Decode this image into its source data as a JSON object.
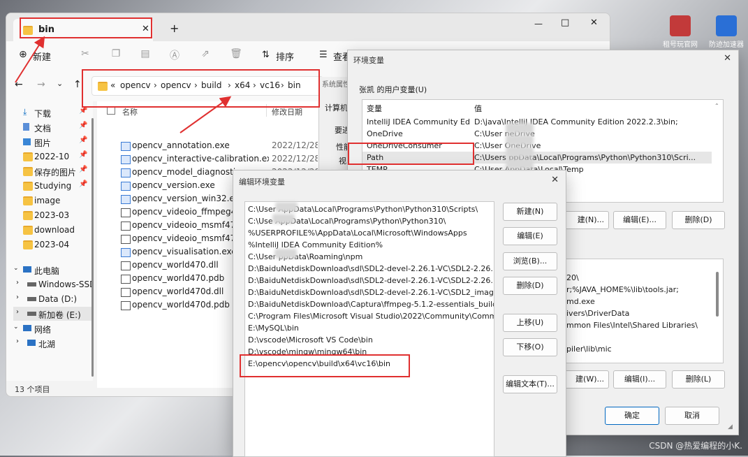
{
  "desktop": {
    "icons": [
      {
        "label": "租号玩官网",
        "color": "#c23a3a"
      },
      {
        "label": "防迹加速器",
        "color": "#2a6fd6"
      }
    ],
    "watermark": "CSDN @热爱编程的小K."
  },
  "explorer": {
    "tab_title": "bin",
    "new_tab_symbol": "+",
    "window_controls": [
      "—",
      "□",
      "✕"
    ],
    "toolbar": {
      "new_label": "新建",
      "sort_label": "排序",
      "view_label": "查看"
    },
    "breadcrumb": [
      "«",
      "opencv",
      "opencv",
      "build",
      "x64",
      "vc16",
      "bin"
    ],
    "sidebar": [
      {
        "label": "下载",
        "pinned": true
      },
      {
        "label": "文档",
        "pinned": true
      },
      {
        "label": "图片",
        "pinned": true
      },
      {
        "label": "2022-10",
        "pinned": true
      },
      {
        "label": "保存的图片",
        "pinned": true
      },
      {
        "label": "Studying",
        "pinned": true
      },
      {
        "label": "image",
        "pinned": false
      },
      {
        "label": "2023-03",
        "pinned": false
      },
      {
        "label": "download",
        "pinned": false
      },
      {
        "label": "2023-04",
        "pinned": false
      },
      {
        "label": "此电脑",
        "pinned": false
      },
      {
        "label": "Windows-SSD",
        "pinned": false
      },
      {
        "label": "Data (D:)",
        "pinned": false
      },
      {
        "label": "新加卷 (E:)",
        "pinned": false
      },
      {
        "label": "网络",
        "pinned": false
      },
      {
        "label": "北湖",
        "pinned": false
      }
    ],
    "columns": {
      "name": "名称",
      "date": "修改日期"
    },
    "files": [
      {
        "name": "opencv_annotation.exe",
        "date": "2022/12/28 2",
        "type": "exe"
      },
      {
        "name": "opencv_interactive-calibration.exe",
        "date": "2022/12/28 2",
        "type": "exe"
      },
      {
        "name": "opencv_model_diagnostics.exe",
        "date": "2022/12/28 2",
        "type": "exe"
      },
      {
        "name": "opencv_version.exe",
        "date": "2022/12/28 2",
        "type": "exe"
      },
      {
        "name": "opencv_version_win32.exe",
        "date": "",
        "type": "exe"
      },
      {
        "name": "opencv_videoio_ffmpeg470",
        "date": "",
        "type": "dll"
      },
      {
        "name": "opencv_videoio_msmf470_6",
        "date": "",
        "type": "dll"
      },
      {
        "name": "opencv_videoio_msmf470_6",
        "date": "",
        "type": "dll"
      },
      {
        "name": "opencv_visualisation.exe",
        "date": "",
        "type": "exe"
      },
      {
        "name": "opencv_world470.dll",
        "date": "",
        "type": "dll"
      },
      {
        "name": "opencv_world470.pdb",
        "date": "",
        "type": "pdb"
      },
      {
        "name": "opencv_world470d.dll",
        "date": "",
        "type": "dll"
      },
      {
        "name": "opencv_world470d.pdb",
        "date": "",
        "type": "pdb"
      }
    ],
    "status": "13 个项目"
  },
  "sysprops": {
    "label": "系统属性",
    "computer_name": "计算机",
    "advanced": "要进",
    "profile": "性能",
    "visual": "视"
  },
  "env_window": {
    "title": "环境变量",
    "user_group_label": "张凯 的用户变量(U)",
    "col_var": "变量",
    "col_val": "值",
    "user_vars": [
      {
        "var": "IntelliJ IDEA Community Ed...",
        "val": "D:\\java\\IntelliJ IDEA Community Edition 2022.2.3\\bin;"
      },
      {
        "var": "OneDrive",
        "val": "C:\\User        neDrive"
      },
      {
        "var": "OneDriveConsumer",
        "val": "C:\\User        OneDrive"
      },
      {
        "var": "Path",
        "val": "C:\\Users        ppData\\Local\\Programs\\Python\\Python310\\Scri..."
      },
      {
        "var": "TEMP",
        "val": "C:\\User        AppData\\Local\\Temp"
      },
      {
        "var": "",
        "val": "ocal\\Temp"
      }
    ],
    "user_buttons": [
      "建(N)...",
      "编辑(E)...",
      "删除(D)"
    ],
    "system_vals": [
      "20\\",
      "r;%JAVA_HOME%\\lib\\tools.jar;",
      "md.exe",
      "ivers\\DriverData",
      "mmon Files\\Intel\\Shared Libraries\\",
      "",
      "piler\\lib\\mic"
    ],
    "system_buttons": [
      "建(W)...",
      "编辑(I)...",
      "删除(L)"
    ],
    "ok": "确定",
    "cancel": "取消"
  },
  "edit_dialog": {
    "title": "编辑环境变量",
    "entries": [
      "C:\\User        AppData\\Local\\Programs\\Python\\Python310\\Scripts\\",
      "C:\\Use         AppData\\Local\\Programs\\Python\\Python310\\",
      "%USERPROFILE%\\AppData\\Local\\Microsoft\\WindowsApps",
      "%IntelliJ IDEA Community Edition%",
      "C:\\User        ppData\\Roaming\\npm",
      "D:\\BaiduNetdiskDownload\\sdl\\SDL2-devel-2.26.1-VC\\SDL2-2.26.1\\...",
      "D:\\BaiduNetdiskDownload\\sdl\\SDL2-devel-2.26.1-VC\\SDL2-2.26.1\\...",
      "D:\\BaiduNetdiskDownload\\sdl\\SDL2-devel-2.26.1-VC\\SDL2_image...",
      "D:\\BaiduNetdiskDownload\\Captura\\ffmpeg-5.1.2-essentials_build\\...",
      "C:\\Program Files\\Microsoft Visual Studio\\2022\\Community\\Comm...",
      "E:\\MySQL\\bin",
      "D:\\vscode\\Microsoft VS Code\\bin",
      "D:\\vscode\\mingw\\mingw64\\bin",
      "E:\\opencv\\opencv\\build\\x64\\vc16\\bin"
    ],
    "buttons": {
      "new": "新建(N)",
      "edit": "编辑(E)",
      "browse": "浏览(B)...",
      "delete": "删除(D)",
      "up": "上移(U)",
      "down": "下移(O)",
      "edit_text": "编辑文本(T)..."
    }
  },
  "colors": {
    "annotation_red": "#e03030",
    "accent_blue": "#0067c0"
  }
}
